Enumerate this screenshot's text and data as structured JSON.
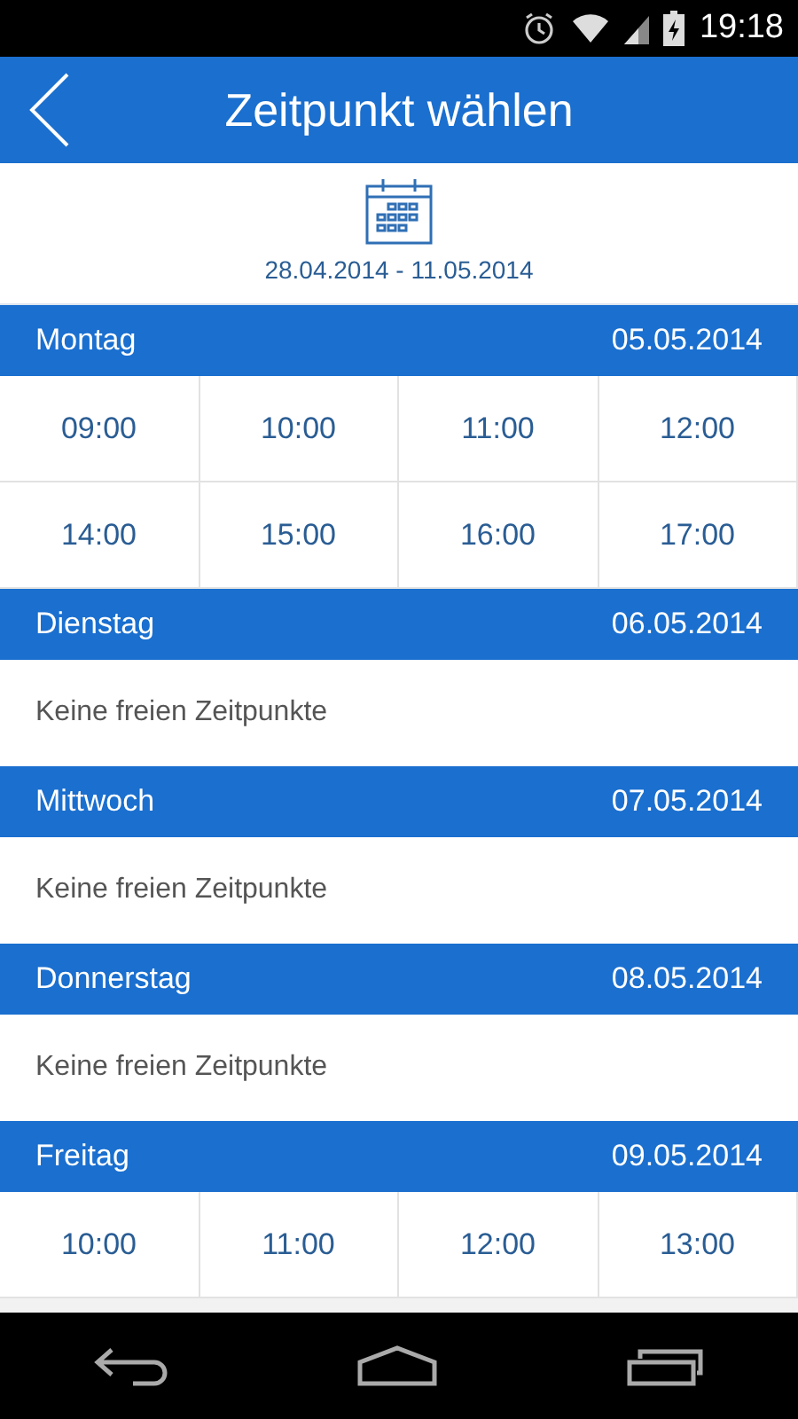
{
  "status_bar": {
    "time": "19:18"
  },
  "app_bar": {
    "title": "Zeitpunkt wählen"
  },
  "range": {
    "text": "28.04.2014 - 11.05.2014"
  },
  "days": [
    {
      "name": "Montag",
      "date": "05.05.2014",
      "slots": [
        "09:00",
        "10:00",
        "11:00",
        "12:00",
        "14:00",
        "15:00",
        "16:00",
        "17:00"
      ]
    },
    {
      "name": "Dienstag",
      "date": "06.05.2014",
      "empty_text": "Keine freien Zeitpunkte"
    },
    {
      "name": "Mittwoch",
      "date": "07.05.2014",
      "empty_text": "Keine freien Zeitpunkte"
    },
    {
      "name": "Donnerstag",
      "date": "08.05.2014",
      "empty_text": "Keine freien Zeitpunkte"
    },
    {
      "name": "Freitag",
      "date": "09.05.2014",
      "slots": [
        "10:00",
        "11:00",
        "12:00",
        "13:00"
      ]
    }
  ]
}
